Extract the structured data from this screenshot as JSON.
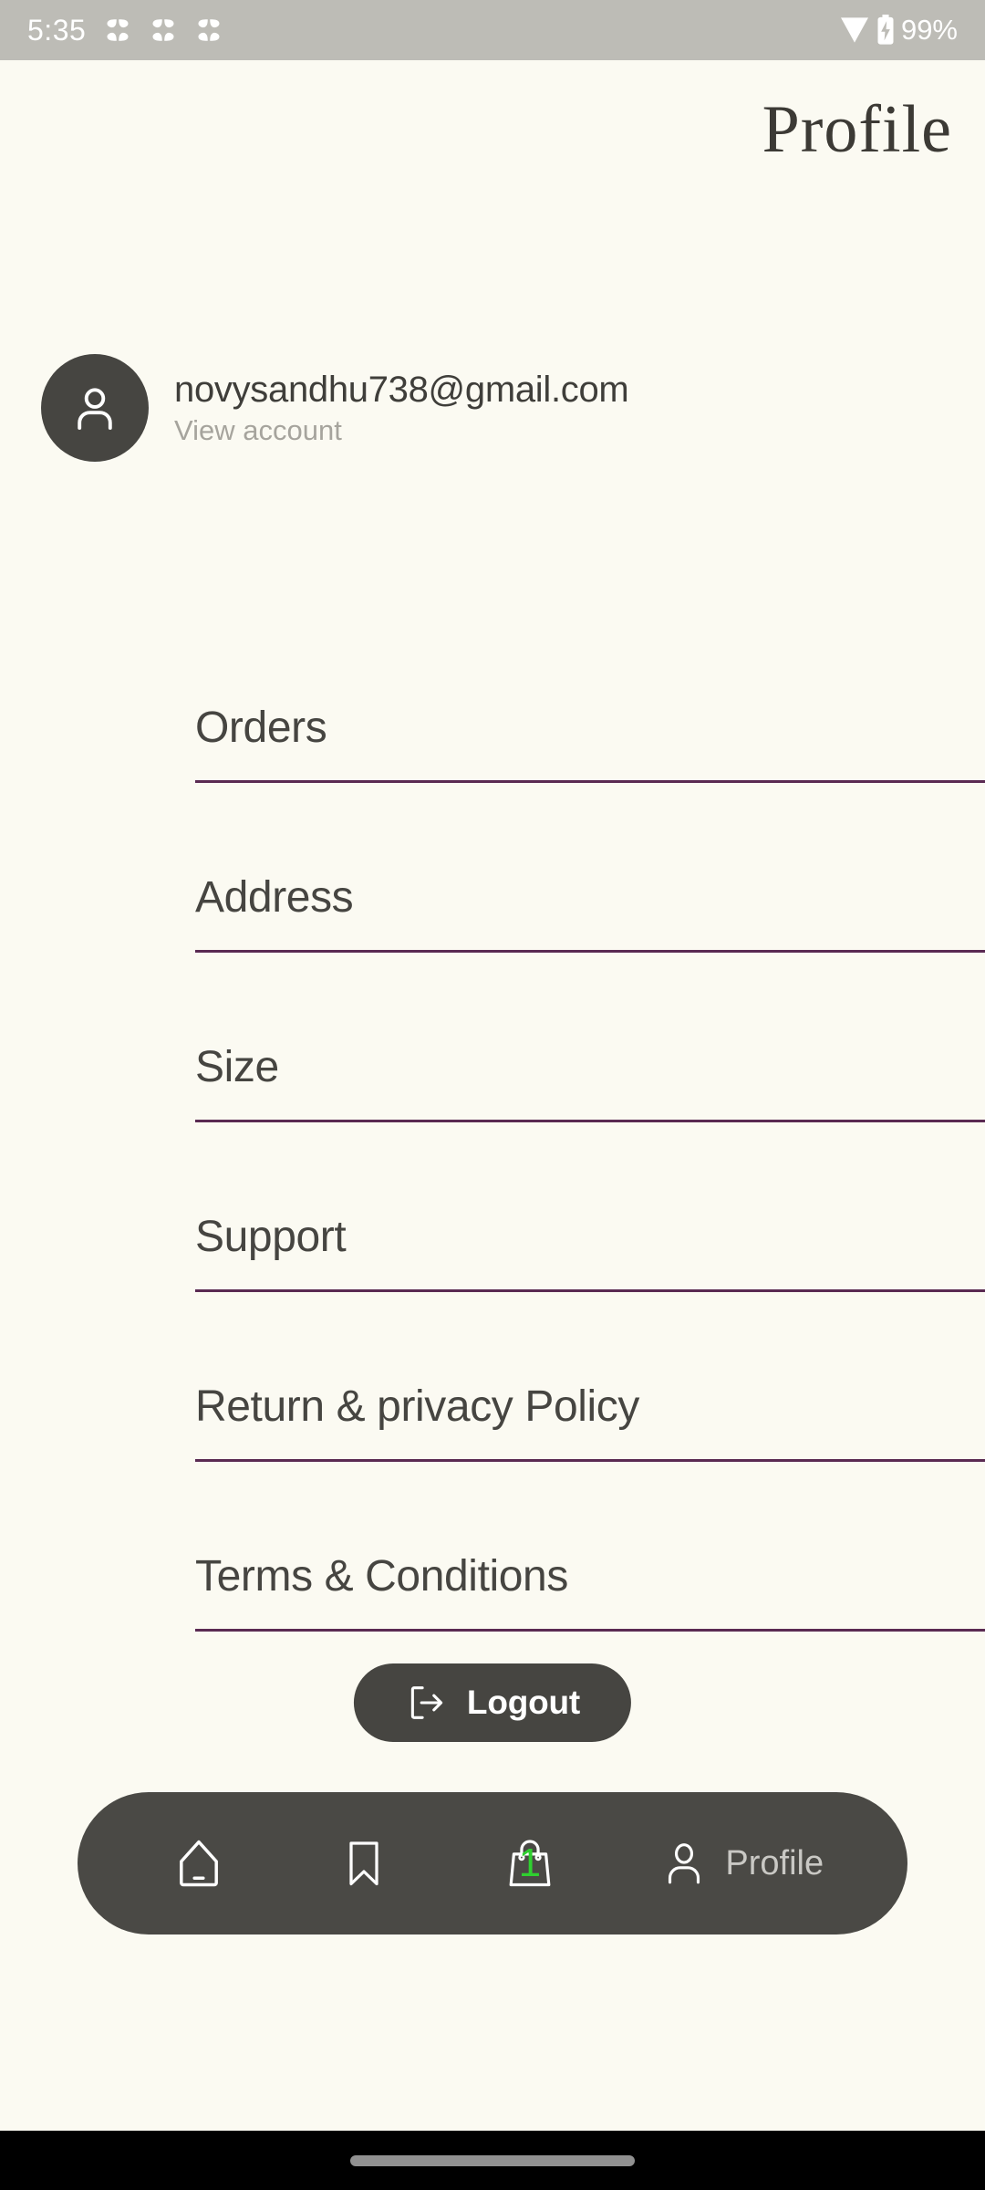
{
  "status_bar": {
    "time": "5:35",
    "battery_percent": "99%",
    "notification_icons": [
      "clover-icon",
      "clover-icon",
      "clover-icon"
    ],
    "wifi_icon": "wifi-icon",
    "battery_icon": "battery-charging-icon",
    "background_color": "#bdbcb6",
    "text_color": "#ffffff"
  },
  "header": {
    "title": "Profile"
  },
  "account": {
    "avatar_icon": "user-avatar-icon",
    "email": "novysandhu738@gmail.com",
    "subtitle": "View account",
    "avatar_color": "#464541"
  },
  "menu": {
    "items": [
      {
        "label": "Orders"
      },
      {
        "label": "Address"
      },
      {
        "label": "Size"
      },
      {
        "label": "Support"
      },
      {
        "label": "Return & privacy Policy"
      },
      {
        "label": "Terms & Conditions"
      }
    ],
    "divider_color": "#5a2a52"
  },
  "logout": {
    "label": "Logout",
    "icon": "logout-arrow-icon",
    "background_color": "#464541",
    "text_color": "#ffffff"
  },
  "bottom_nav": {
    "background_color": "#4a4945",
    "active_item": "Profile",
    "items": [
      {
        "icon": "home-icon",
        "label": ""
      },
      {
        "icon": "bookmark-icon",
        "label": ""
      },
      {
        "icon": "shopping-bag-icon",
        "label": "",
        "badge": "1",
        "badge_color": "#2fd02f"
      },
      {
        "icon": "person-icon",
        "label": "Profile"
      }
    ]
  },
  "theme": {
    "background": "#fbfaf2",
    "text_primary": "#464541",
    "text_muted": "#a6a49d",
    "accent_purple": "#5a2a52",
    "accent_green": "#2fd02f"
  }
}
